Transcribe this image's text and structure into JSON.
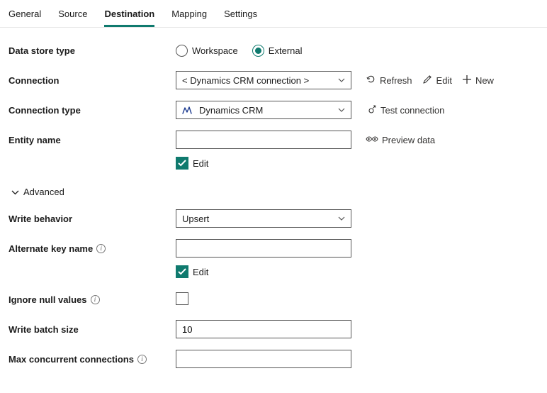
{
  "tabs": {
    "general": "General",
    "source": "Source",
    "destination": "Destination",
    "mapping": "Mapping",
    "settings": "Settings",
    "active": "destination"
  },
  "labels": {
    "data_store_type": "Data store type",
    "connection": "Connection",
    "connection_type": "Connection type",
    "entity_name": "Entity name",
    "advanced": "Advanced",
    "write_behavior": "Write behavior",
    "alternate_key": "Alternate key name",
    "ignore_null": "Ignore null values",
    "write_batch": "Write batch size",
    "max_concurrent": "Max concurrent connections"
  },
  "data_store_type": {
    "workspace": "Workspace",
    "external": "External",
    "selected": "external"
  },
  "connection": {
    "selected": "< Dynamics CRM connection >"
  },
  "connection_type": {
    "selected": "Dynamics CRM"
  },
  "entity_name": {
    "value": "",
    "edit_checked": true,
    "edit_label": "Edit"
  },
  "actions": {
    "refresh": "Refresh",
    "edit": "Edit",
    "new": "New",
    "test_connection": "Test connection",
    "preview_data": "Preview data"
  },
  "write_behavior": {
    "selected": "Upsert"
  },
  "alternate_key": {
    "value": "",
    "edit_checked": true,
    "edit_label": "Edit"
  },
  "ignore_null": {
    "checked": false
  },
  "write_batch": {
    "value": "10"
  },
  "max_concurrent": {
    "value": ""
  }
}
